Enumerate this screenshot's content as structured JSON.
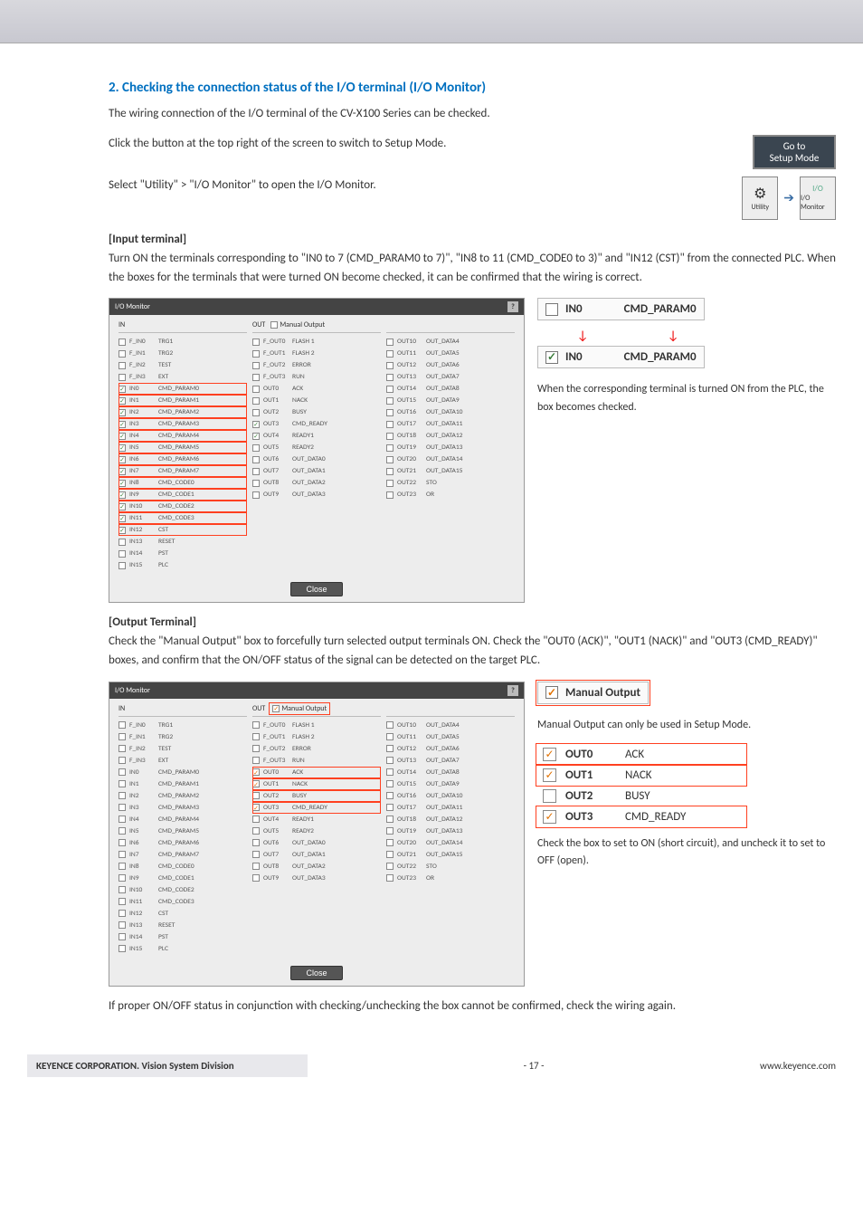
{
  "section_title": "2. Checking the connection status of the I/O terminal (I/O Monitor)",
  "intro_text": "The wiring connection of the I/O terminal of the CV-X100 Series can be checked.",
  "step1_text": "Click the button at the top right of the screen to switch to Setup Mode.",
  "step2_text": "Select \"Utility\" > \"I/O Monitor\" to open the I/O Monitor.",
  "setup_btn": "Go to\nSetup Mode",
  "utility_label": "Utility",
  "io_mon_label": "I/O Monitor",
  "io_mon_small": "I/O",
  "input_heading": "[Input terminal]",
  "input_text": "Turn ON the terminals corresponding to \"IN0 to 7 (CMD_PARAM0 to 7)\", \"IN8 to 11 (CMD_CODE0 to 3)\" and \"IN12 (CST)\" from the connected PLC. When the boxes for the terminals that were turned ON become checked, it can be confirmed that the wiring is correct.",
  "output_heading": "[Output Terminal]",
  "output_text": "Check the \"Manual Output\" box to forcefully turn selected output terminals ON. Check the \"OUT0 (ACK)\", \"OUT1 (NACK)\" and \"OUT3 (CMD_READY)\" boxes, and confirm that the ON/OFF status of the signal can be detected on the target PLC.",
  "monitor_title": "I/O Monitor",
  "in_label": "IN",
  "out_label": "OUT",
  "manual_output_label": "Manual Output",
  "close_label": "Close",
  "callout1_sig": "IN0",
  "callout1_lbl": "CMD_PARAM0",
  "explain1": "When the corresponding terminal is turned ON from the PLC, the box becomes checked.",
  "explain2a": "Manual Output can only be used in Setup Mode.",
  "explain2b": "Check the box to set to ON (short circuit), and uncheck it to set to OFF (open).",
  "closing_text": "If proper ON/OFF status in conjunction with checking/unchecking the box cannot be confirmed, check the wiring again.",
  "footer_left": "KEYENCE CORPORATION. Vision System Division",
  "footer_center": "- 17 -",
  "footer_right": "www.keyence.com",
  "in_rows": [
    {
      "sig": "F_IN0",
      "lbl": "TRG1",
      "c": false
    },
    {
      "sig": "F_IN1",
      "lbl": "TRG2",
      "c": false
    },
    {
      "sig": "F_IN2",
      "lbl": "TEST",
      "c": false
    },
    {
      "sig": "F_IN3",
      "lbl": "EXT",
      "c": false
    },
    {
      "sig": "IN0",
      "lbl": "CMD_PARAM0",
      "c": true
    },
    {
      "sig": "IN1",
      "lbl": "CMD_PARAM1",
      "c": true
    },
    {
      "sig": "IN2",
      "lbl": "CMD_PARAM2",
      "c": true
    },
    {
      "sig": "IN3",
      "lbl": "CMD_PARAM3",
      "c": true
    },
    {
      "sig": "IN4",
      "lbl": "CMD_PARAM4",
      "c": true
    },
    {
      "sig": "IN5",
      "lbl": "CMD_PARAM5",
      "c": true
    },
    {
      "sig": "IN6",
      "lbl": "CMD_PARAM6",
      "c": true
    },
    {
      "sig": "IN7",
      "lbl": "CMD_PARAM7",
      "c": true
    },
    {
      "sig": "IN8",
      "lbl": "CMD_CODE0",
      "c": true
    },
    {
      "sig": "IN9",
      "lbl": "CMD_CODE1",
      "c": true
    },
    {
      "sig": "IN10",
      "lbl": "CMD_CODE2",
      "c": true
    },
    {
      "sig": "IN11",
      "lbl": "CMD_CODE3",
      "c": true
    },
    {
      "sig": "IN12",
      "lbl": "CST",
      "c": true
    },
    {
      "sig": "IN13",
      "lbl": "RESET",
      "c": false
    },
    {
      "sig": "IN14",
      "lbl": "PST",
      "c": false
    },
    {
      "sig": "IN15",
      "lbl": "PLC",
      "c": false
    }
  ],
  "out_a": [
    {
      "sig": "F_OUT0",
      "lbl": "FLASH 1",
      "c": false
    },
    {
      "sig": "F_OUT1",
      "lbl": "FLASH 2",
      "c": false
    },
    {
      "sig": "F_OUT2",
      "lbl": "ERROR",
      "c": false
    },
    {
      "sig": "F_OUT3",
      "lbl": "RUN",
      "c": false
    },
    {
      "sig": "OUT0",
      "lbl": "ACK",
      "c": false
    },
    {
      "sig": "OUT1",
      "lbl": "NACK",
      "c": false
    },
    {
      "sig": "OUT2",
      "lbl": "BUSY",
      "c": false
    },
    {
      "sig": "OUT3",
      "lbl": "CMD_READY",
      "c": true
    },
    {
      "sig": "OUT4",
      "lbl": "READY1",
      "c": true
    },
    {
      "sig": "OUT5",
      "lbl": "READY2",
      "c": false
    },
    {
      "sig": "OUT6",
      "lbl": "OUT_DATA0",
      "c": false
    },
    {
      "sig": "OUT7",
      "lbl": "OUT_DATA1",
      "c": false
    },
    {
      "sig": "OUT8",
      "lbl": "OUT_DATA2",
      "c": false
    },
    {
      "sig": "OUT9",
      "lbl": "OUT_DATA3",
      "c": false
    }
  ],
  "out_b": [
    {
      "sig": "OUT10",
      "lbl": "OUT_DATA4",
      "c": false
    },
    {
      "sig": "OUT11",
      "lbl": "OUT_DATA5",
      "c": false
    },
    {
      "sig": "OUT12",
      "lbl": "OUT_DATA6",
      "c": false
    },
    {
      "sig": "OUT13",
      "lbl": "OUT_DATA7",
      "c": false
    },
    {
      "sig": "OUT14",
      "lbl": "OUT_DATA8",
      "c": false
    },
    {
      "sig": "OUT15",
      "lbl": "OUT_DATA9",
      "c": false
    },
    {
      "sig": "OUT16",
      "lbl": "OUT_DATA10",
      "c": false
    },
    {
      "sig": "OUT17",
      "lbl": "OUT_DATA11",
      "c": false
    },
    {
      "sig": "OUT18",
      "lbl": "OUT_DATA12",
      "c": false
    },
    {
      "sig": "OUT19",
      "lbl": "OUT_DATA13",
      "c": false
    },
    {
      "sig": "OUT20",
      "lbl": "OUT_DATA14",
      "c": false
    },
    {
      "sig": "OUT21",
      "lbl": "OUT_DATA15",
      "c": false
    },
    {
      "sig": "OUT22",
      "lbl": "STO",
      "c": false
    },
    {
      "sig": "OUT23",
      "lbl": "OR",
      "c": false
    }
  ],
  "out2_a": [
    {
      "sig": "F_OUT0",
      "lbl": "FLASH 1",
      "c": false
    },
    {
      "sig": "F_OUT1",
      "lbl": "FLASH 2",
      "c": false
    },
    {
      "sig": "F_OUT2",
      "lbl": "ERROR",
      "c": false
    },
    {
      "sig": "F_OUT3",
      "lbl": "RUN",
      "c": false
    },
    {
      "sig": "OUT0",
      "lbl": "ACK",
      "c": true
    },
    {
      "sig": "OUT1",
      "lbl": "NACK",
      "c": true
    },
    {
      "sig": "OUT2",
      "lbl": "BUSY",
      "c": false
    },
    {
      "sig": "OUT3",
      "lbl": "CMD_READY",
      "c": true
    },
    {
      "sig": "OUT4",
      "lbl": "READY1",
      "c": false
    },
    {
      "sig": "OUT5",
      "lbl": "READY2",
      "c": false
    },
    {
      "sig": "OUT6",
      "lbl": "OUT_DATA0",
      "c": false
    },
    {
      "sig": "OUT7",
      "lbl": "OUT_DATA1",
      "c": false
    },
    {
      "sig": "OUT8",
      "lbl": "OUT_DATA2",
      "c": false
    },
    {
      "sig": "OUT9",
      "lbl": "OUT_DATA3",
      "c": false
    }
  ],
  "in2_rows": [
    {
      "sig": "F_IN0",
      "lbl": "TRG1",
      "c": false
    },
    {
      "sig": "F_IN1",
      "lbl": "TRG2",
      "c": false
    },
    {
      "sig": "F_IN2",
      "lbl": "TEST",
      "c": false
    },
    {
      "sig": "F_IN3",
      "lbl": "EXT",
      "c": false
    },
    {
      "sig": "IN0",
      "lbl": "CMD_PARAM0",
      "c": false
    },
    {
      "sig": "IN1",
      "lbl": "CMD_PARAM1",
      "c": false
    },
    {
      "sig": "IN2",
      "lbl": "CMD_PARAM2",
      "c": false
    },
    {
      "sig": "IN3",
      "lbl": "CMD_PARAM3",
      "c": false
    },
    {
      "sig": "IN4",
      "lbl": "CMD_PARAM4",
      "c": false
    },
    {
      "sig": "IN5",
      "lbl": "CMD_PARAM5",
      "c": false
    },
    {
      "sig": "IN6",
      "lbl": "CMD_PARAM6",
      "c": false
    },
    {
      "sig": "IN7",
      "lbl": "CMD_PARAM7",
      "c": false
    },
    {
      "sig": "IN8",
      "lbl": "CMD_CODE0",
      "c": false
    },
    {
      "sig": "IN9",
      "lbl": "CMD_CODE1",
      "c": false
    },
    {
      "sig": "IN10",
      "lbl": "CMD_CODE2",
      "c": false
    },
    {
      "sig": "IN11",
      "lbl": "CMD_CODE3",
      "c": false
    },
    {
      "sig": "IN12",
      "lbl": "CST",
      "c": false
    },
    {
      "sig": "IN13",
      "lbl": "RESET",
      "c": false
    },
    {
      "sig": "IN14",
      "lbl": "PST",
      "c": false
    },
    {
      "sig": "IN15",
      "lbl": "PLC",
      "c": false
    }
  ],
  "chk_rows": [
    {
      "sig": "OUT0",
      "lbl": "ACK",
      "c": true
    },
    {
      "sig": "OUT1",
      "lbl": "NACK",
      "c": true
    },
    {
      "sig": "OUT2",
      "lbl": "BUSY",
      "c": false
    },
    {
      "sig": "OUT3",
      "lbl": "CMD_READY",
      "c": true
    }
  ]
}
